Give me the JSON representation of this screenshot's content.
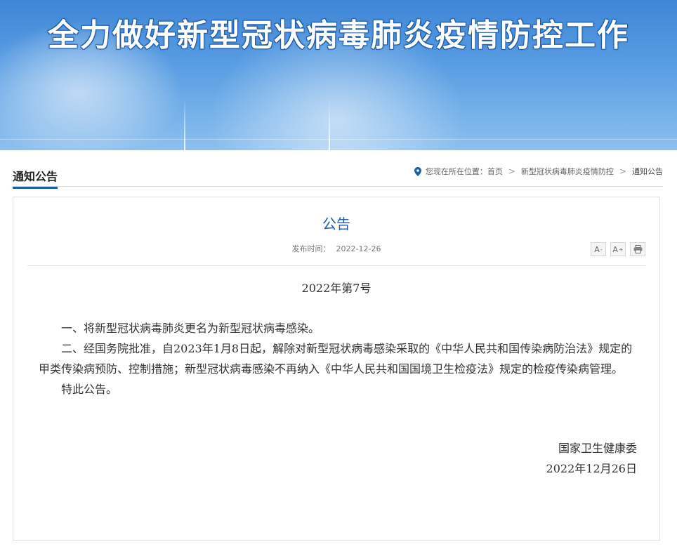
{
  "banner": {
    "title": "全力做好新型冠状病毒肺炎疫情防控工作"
  },
  "column": {
    "title": "通知公告"
  },
  "breadcrumb": {
    "prefix": "您现在所在位置：",
    "items": [
      "首页",
      "新型冠状病毒肺炎疫情防控",
      "通知公告"
    ],
    "separator": ">"
  },
  "article": {
    "title": "公告",
    "publish_label": "发布时间：",
    "publish_date": "2022-12-26",
    "doc_number": "2022年第7号",
    "paragraphs": [
      "一、将新型冠状病毒肺炎更名为新型冠状病毒感染。",
      "二、经国务院批准，自2023年1月8日起，解除对新型冠状病毒感染采取的《中华人民共和国传染病防治法》规定的甲类传染病预防、控制措施；新型冠状病毒感染不再纳入《中华人民共和国国境卫生检疫法》规定的检疫传染病管理。",
      "特此公告。"
    ],
    "signature": {
      "org": "国家卫生健康委",
      "date": "2022年12月26日"
    }
  },
  "tools": {
    "font_decrease": "A",
    "font_decrease_sup": "-",
    "font_increase": "A",
    "font_increase_sup": "+",
    "print_icon": "printer-icon"
  },
  "colors": {
    "accent": "#1f5da8",
    "banner_top": "#3f86d6",
    "banner_bottom": "#8cc0ef"
  }
}
